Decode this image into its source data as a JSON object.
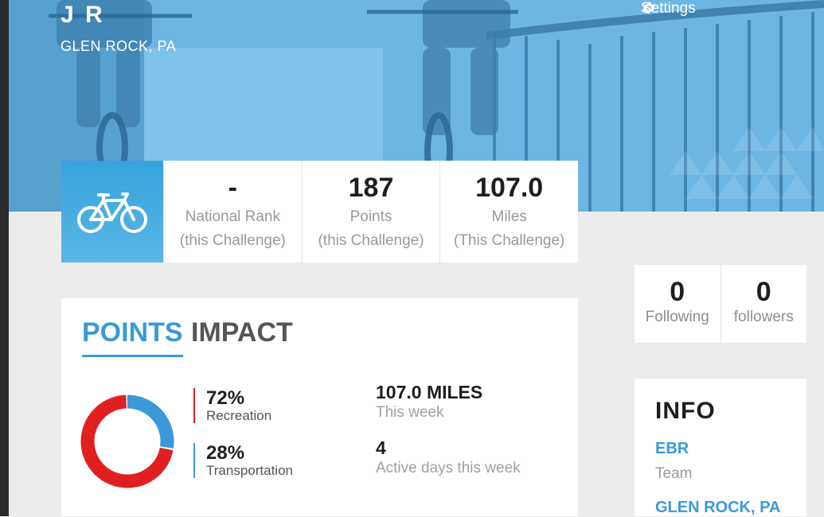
{
  "profile": {
    "name": "J R",
    "location": "GLEN ROCK, PA",
    "settings_label": "Settings"
  },
  "stats": [
    {
      "value": "-",
      "label_line1": "National Rank",
      "label_line2": "(this Challenge)"
    },
    {
      "value": "187",
      "label_line1": "Points",
      "label_line2": "(this Challenge)"
    },
    {
      "value": "107.0",
      "label_line1": "Miles",
      "label_line2": "(This Challenge)"
    }
  ],
  "follow": {
    "following_count": "0",
    "following_label": "Following",
    "followers_count": "0",
    "followers_label": "followers"
  },
  "points_card": {
    "tabs": [
      {
        "label": "POINTS",
        "active": true
      },
      {
        "label": "IMPACT",
        "active": false
      }
    ],
    "breakdown": [
      {
        "percent": "72%",
        "label": "Recreation",
        "value": 72,
        "color": "#e02020"
      },
      {
        "percent": "28%",
        "label": "Transportation",
        "value": 28,
        "color": "#3a9ad9"
      }
    ],
    "week_stats": [
      {
        "value": "107.0 MILES",
        "label": "This week"
      },
      {
        "value": "4",
        "label": "Active days this week"
      }
    ]
  },
  "info": {
    "title": "INFO",
    "team_name": "EBR",
    "team_label": "Team",
    "city": "GLEN ROCK, PA"
  },
  "icons": {
    "gear": "gear-icon",
    "bike": "bicycle-icon"
  },
  "colors": {
    "accent": "#3a9ad9",
    "recreation": "#e02020",
    "transportation": "#3a9ad9"
  }
}
